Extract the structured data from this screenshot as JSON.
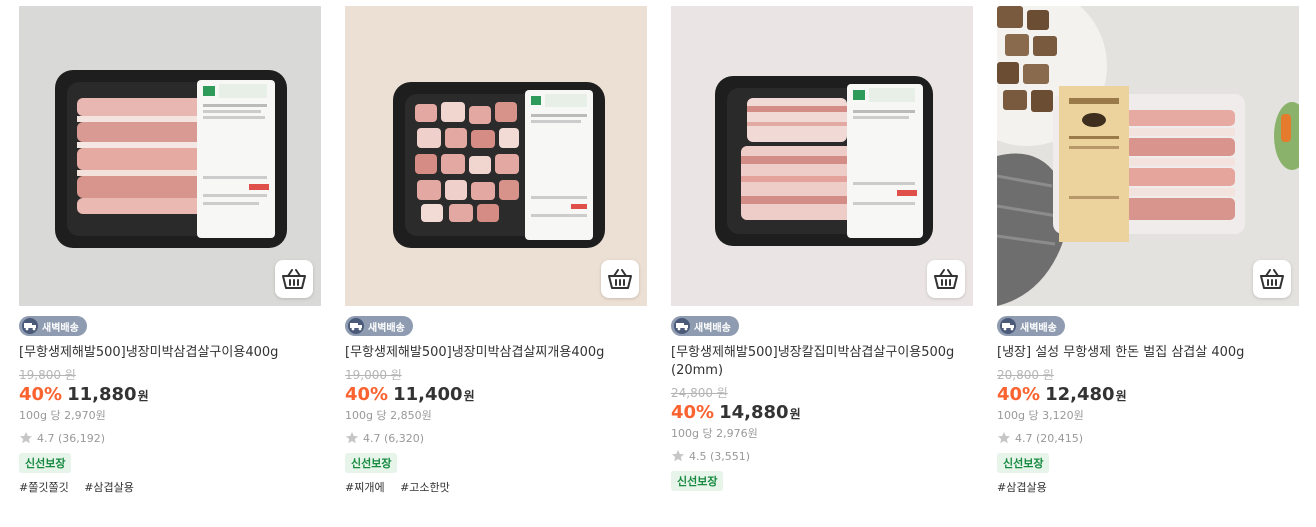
{
  "colors": {
    "discount": "#fa622f",
    "badge_bg": "#8e9bb0",
    "fresh_bg": "#e6f4ea",
    "fresh_text": "#178a3f"
  },
  "products": [
    {
      "badge": "새벽배송",
      "name": "[무항생제해발500]냉장미박삼겹살구이용400g",
      "original_price": "19,800 원",
      "discount": "40%",
      "price": "11,880",
      "currency": "원",
      "unit_price": "100g 당 2,970원",
      "rating": "4.7 (36,192)",
      "tag": "신선보장",
      "hashtags": [
        "#쫄깃쫄깃",
        "#삼겹살용"
      ],
      "icon": "basket-icon"
    },
    {
      "badge": "새벽배송",
      "name": "[무항생제해발500]냉장미박삼겹살찌개용400g",
      "original_price": "19,000 원",
      "discount": "40%",
      "price": "11,400",
      "currency": "원",
      "unit_price": "100g 당 2,850원",
      "rating": "4.7 (6,320)",
      "tag": "신선보장",
      "hashtags": [
        "#찌개에",
        "#고소한맛"
      ],
      "icon": "basket-icon"
    },
    {
      "badge": "새벽배송",
      "name": "[무항생제해발500]냉장칼집미박삼겹살구이용500g (20mm)",
      "original_price": "24,800 원",
      "discount": "40%",
      "price": "14,880",
      "currency": "원",
      "unit_price": "100g 당 2,976원",
      "rating": "4.5 (3,551)",
      "tag": "신선보장",
      "hashtags": [],
      "icon": "basket-icon"
    },
    {
      "badge": "새벽배송",
      "name": "[냉장] 설성 무항생제 한돈 벌집 삼겹살 400g",
      "original_price": "20,800 원",
      "discount": "40%",
      "price": "12,480",
      "currency": "원",
      "unit_price": "100g 당 3,120원",
      "rating": "4.7 (20,415)",
      "tag": "신선보장",
      "hashtags": [
        "#삼겹살용"
      ],
      "icon": "basket-icon"
    }
  ]
}
